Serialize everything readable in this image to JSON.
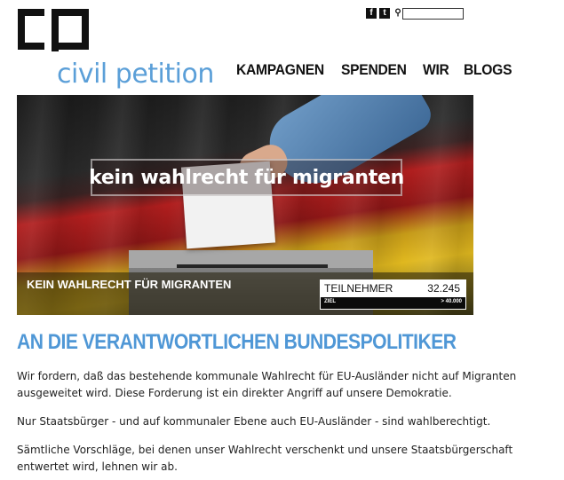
{
  "brand": {
    "name": "civil petition",
    "logo_icon": "cp-logo-icon",
    "color": "#5b9fd8"
  },
  "header": {
    "social": [
      {
        "name": "facebook-icon",
        "glyph": "f"
      },
      {
        "name": "twitter-icon",
        "glyph": "t"
      },
      {
        "name": "search-icon",
        "glyph": "⚲"
      }
    ],
    "search_value": ""
  },
  "nav": {
    "items": [
      "KAMPAGNEN",
      "SPENDEN",
      "WIR",
      "BLOGS"
    ]
  },
  "hero": {
    "overlay_title": "kein wahlrecht für migranten",
    "subtitle": "KEIN WAHLRECHT FÜR MIGRANTEN",
    "counter": {
      "label": "TEILNEHMER",
      "value": "32.245",
      "goal_label": "ZIEL",
      "goal_value": "> 40.000"
    }
  },
  "main": {
    "headline": "AN DIE VERANTWORTLICHEN BUNDESPOLITIKER",
    "headline_color": "#4f97d6",
    "paragraphs": [
      "Wir fordern, daß das bestehende kommunale Wahlrecht für EU-Ausländer nicht auf Migranten ausgeweitet wird. Diese Forderung ist ein direkter Angriff auf unsere Demokratie.",
      "Nur Staatsbürger - und auf kommunaler Ebene auch EU-Ausländer - sind wahlberechtigt.",
      "Sämtliche Vorschläge, bei denen unser Wahlrecht verschenkt und unsere Staatsbürgerschaft entwertet wird, lehnen wir ab."
    ]
  }
}
